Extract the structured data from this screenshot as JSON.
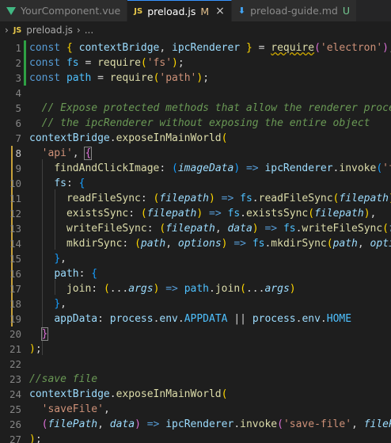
{
  "tabs": [
    {
      "label": "YourComponent.vue",
      "icon": "vue-icon",
      "active": false
    },
    {
      "label": "preload.js",
      "icon": "js-icon",
      "modified": "M",
      "close": "×",
      "active": true
    },
    {
      "label": "preload-guide.md",
      "icon": "markdown-icon",
      "modified": "U",
      "active": false
    }
  ],
  "breadcrumb": {
    "chevron": "›",
    "icon_text": "JS",
    "file": "preload.js",
    "separator": "›",
    "more": "..."
  },
  "editor": {
    "lines": [
      {
        "n": "1",
        "mod": true,
        "tokens": [
          [
            "kw",
            "const "
          ],
          [
            "b1",
            "{ "
          ],
          [
            "var",
            "contextBridge"
          ],
          [
            "op",
            ", "
          ],
          [
            "var",
            "ipcRenderer"
          ],
          [
            "b1",
            " }"
          ],
          [
            "op",
            " = "
          ],
          [
            "fn squig",
            "require"
          ],
          [
            "b2",
            "("
          ],
          [
            "str",
            "'electron'"
          ],
          [
            "b2",
            ")"
          ],
          [
            "op",
            ";"
          ]
        ]
      },
      {
        "n": "2",
        "mod": true,
        "tokens": [
          [
            "kw",
            "const "
          ],
          [
            "cst",
            "fs"
          ],
          [
            "op",
            " = "
          ],
          [
            "fn",
            "require"
          ],
          [
            "b1",
            "("
          ],
          [
            "str",
            "'fs'"
          ],
          [
            "b1",
            ")"
          ],
          [
            "op",
            ";"
          ]
        ]
      },
      {
        "n": "3",
        "mod": true,
        "tokens": [
          [
            "kw",
            "const "
          ],
          [
            "cst",
            "path"
          ],
          [
            "op",
            " = "
          ],
          [
            "fn",
            "require"
          ],
          [
            "b1",
            "("
          ],
          [
            "str",
            "'path'"
          ],
          [
            "b1",
            ")"
          ],
          [
            "op",
            ";"
          ]
        ]
      },
      {
        "n": "4",
        "tokens": []
      },
      {
        "n": "5",
        "tokens": [
          [
            "cmt",
            "  // Expose protected methods that allow the renderer process"
          ]
        ]
      },
      {
        "n": "6",
        "tokens": [
          [
            "cmt",
            "  // the ipcRenderer without exposing the entire object"
          ]
        ]
      },
      {
        "n": "7",
        "tokens": [
          [
            "var",
            "contextBridge"
          ],
          [
            "op",
            "."
          ],
          [
            "fn",
            "exposeInMainWorld"
          ],
          [
            "b1",
            "("
          ]
        ]
      },
      {
        "n": "8",
        "current": true,
        "warn": true,
        "tokens": [
          [
            "op",
            "  "
          ],
          [
            "str",
            "'api'"
          ],
          [
            "op",
            ", "
          ],
          [
            "b2 hl-bracket",
            "{"
          ]
        ]
      },
      {
        "n": "9",
        "warn": true,
        "tokens": [
          [
            "op",
            "    "
          ],
          [
            "fn",
            "findAndClickImage"
          ],
          [
            "op",
            ": "
          ],
          [
            "b3",
            "("
          ],
          [
            "prm",
            "imageData"
          ],
          [
            "b3",
            ")"
          ],
          [
            "kw",
            " =>"
          ],
          [
            "op",
            " "
          ],
          [
            "var",
            "ipcRenderer"
          ],
          [
            "op",
            "."
          ],
          [
            "fn",
            "invoke"
          ],
          [
            "b3",
            "("
          ],
          [
            "str",
            "'f"
          ]
        ]
      },
      {
        "n": "10",
        "warn": true,
        "tokens": [
          [
            "op",
            "    "
          ],
          [
            "prop",
            "fs"
          ],
          [
            "op",
            ": "
          ],
          [
            "b3",
            "{"
          ]
        ]
      },
      {
        "n": "11",
        "warn": true,
        "tokens": [
          [
            "op",
            "      "
          ],
          [
            "fn",
            "readFileSync"
          ],
          [
            "op",
            ": "
          ],
          [
            "b1",
            "("
          ],
          [
            "prm",
            "filepath"
          ],
          [
            "b1",
            ")"
          ],
          [
            "kw",
            " =>"
          ],
          [
            "op",
            " "
          ],
          [
            "cst",
            "fs"
          ],
          [
            "op",
            "."
          ],
          [
            "fn",
            "readFileSync"
          ],
          [
            "b1",
            "("
          ],
          [
            "prm",
            "filepath"
          ],
          [
            "b1",
            ")"
          ]
        ]
      },
      {
        "n": "12",
        "warn": true,
        "tokens": [
          [
            "op",
            "      "
          ],
          [
            "fn",
            "existsSync"
          ],
          [
            "op",
            ": "
          ],
          [
            "b1",
            "("
          ],
          [
            "prm",
            "filepath"
          ],
          [
            "b1",
            ")"
          ],
          [
            "kw",
            " =>"
          ],
          [
            "op",
            " "
          ],
          [
            "cst",
            "fs"
          ],
          [
            "op",
            "."
          ],
          [
            "fn",
            "existsSync"
          ],
          [
            "b1",
            "("
          ],
          [
            "prm",
            "filepath"
          ],
          [
            "b1",
            ")"
          ],
          [
            "op",
            ","
          ]
        ]
      },
      {
        "n": "13",
        "warn": true,
        "tokens": [
          [
            "op",
            "      "
          ],
          [
            "fn",
            "writeFileSync"
          ],
          [
            "op",
            ": "
          ],
          [
            "b1",
            "("
          ],
          [
            "prm",
            "filepath"
          ],
          [
            "op",
            ", "
          ],
          [
            "prm",
            "data"
          ],
          [
            "b1",
            ")"
          ],
          [
            "kw",
            " =>"
          ],
          [
            "op",
            " "
          ],
          [
            "cst",
            "fs"
          ],
          [
            "op",
            "."
          ],
          [
            "fn",
            "writeFileSync"
          ],
          [
            "b1",
            "("
          ],
          [
            "prm",
            "f"
          ]
        ]
      },
      {
        "n": "14",
        "warn": true,
        "tokens": [
          [
            "op",
            "      "
          ],
          [
            "fn",
            "mkdirSync"
          ],
          [
            "op",
            ": "
          ],
          [
            "b1",
            "("
          ],
          [
            "prm",
            "path"
          ],
          [
            "op",
            ", "
          ],
          [
            "prm",
            "options"
          ],
          [
            "b1",
            ")"
          ],
          [
            "kw",
            " =>"
          ],
          [
            "op",
            " "
          ],
          [
            "cst",
            "fs"
          ],
          [
            "op",
            "."
          ],
          [
            "fn",
            "mkdirSync"
          ],
          [
            "b1",
            "("
          ],
          [
            "prm",
            "path"
          ],
          [
            "op",
            ", "
          ],
          [
            "prm",
            "opti"
          ]
        ]
      },
      {
        "n": "15",
        "warn": true,
        "tokens": [
          [
            "op",
            "    "
          ],
          [
            "b3",
            "}"
          ],
          [
            "op",
            ","
          ]
        ]
      },
      {
        "n": "16",
        "warn": true,
        "tokens": [
          [
            "op",
            "    "
          ],
          [
            "prop",
            "path"
          ],
          [
            "op",
            ": "
          ],
          [
            "b3",
            "{"
          ]
        ]
      },
      {
        "n": "17",
        "warn": true,
        "tokens": [
          [
            "op",
            "      "
          ],
          [
            "fn",
            "join"
          ],
          [
            "op",
            ": "
          ],
          [
            "b1",
            "("
          ],
          [
            "op",
            "..."
          ],
          [
            "prm",
            "args"
          ],
          [
            "b1",
            ")"
          ],
          [
            "kw",
            " =>"
          ],
          [
            "op",
            " "
          ],
          [
            "cst",
            "path"
          ],
          [
            "op",
            "."
          ],
          [
            "fn",
            "join"
          ],
          [
            "b1",
            "("
          ],
          [
            "op",
            "..."
          ],
          [
            "prm",
            "args"
          ],
          [
            "b1",
            ")"
          ]
        ]
      },
      {
        "n": "18",
        "warn": true,
        "tokens": [
          [
            "op",
            "    "
          ],
          [
            "b3",
            "}"
          ],
          [
            "op",
            ","
          ]
        ]
      },
      {
        "n": "19",
        "warn": true,
        "tokens": [
          [
            "op",
            "    "
          ],
          [
            "prop",
            "appData"
          ],
          [
            "op",
            ": "
          ],
          [
            "var",
            "process"
          ],
          [
            "op",
            "."
          ],
          [
            "var",
            "env"
          ],
          [
            "op",
            "."
          ],
          [
            "cst",
            "APPDATA"
          ],
          [
            "op",
            " || "
          ],
          [
            "var",
            "process"
          ],
          [
            "op",
            "."
          ],
          [
            "var",
            "env"
          ],
          [
            "op",
            "."
          ],
          [
            "cst",
            "HOME"
          ]
        ]
      },
      {
        "n": "20",
        "tokens": [
          [
            "op",
            "  "
          ],
          [
            "b2 hl-bracket",
            "}"
          ]
        ]
      },
      {
        "n": "21",
        "tokens": [
          [
            "b1",
            ")"
          ],
          [
            "op",
            ";"
          ]
        ]
      },
      {
        "n": "22",
        "tokens": []
      },
      {
        "n": "23",
        "tokens": [
          [
            "cmt",
            "//save file"
          ]
        ]
      },
      {
        "n": "24",
        "tokens": [
          [
            "var",
            "contextBridge"
          ],
          [
            "op",
            "."
          ],
          [
            "fn",
            "exposeInMainWorld"
          ],
          [
            "b1",
            "("
          ]
        ]
      },
      {
        "n": "25",
        "tokens": [
          [
            "op",
            "  "
          ],
          [
            "str",
            "'saveFile'"
          ],
          [
            "op",
            ","
          ]
        ]
      },
      {
        "n": "26",
        "tokens": [
          [
            "op",
            "  "
          ],
          [
            "b2",
            "("
          ],
          [
            "prm",
            "filePath"
          ],
          [
            "op",
            ", "
          ],
          [
            "prm",
            "data"
          ],
          [
            "b2",
            ")"
          ],
          [
            "kw",
            " =>"
          ],
          [
            "op",
            " "
          ],
          [
            "var",
            "ipcRenderer"
          ],
          [
            "op",
            "."
          ],
          [
            "fn",
            "invoke"
          ],
          [
            "b2",
            "("
          ],
          [
            "str",
            "'save-file'"
          ],
          [
            "op",
            ", "
          ],
          [
            "prm",
            "fileP"
          ]
        ]
      },
      {
        "n": "27",
        "tokens": [
          [
            "b1",
            ")"
          ],
          [
            "op",
            ";"
          ]
        ]
      }
    ]
  }
}
